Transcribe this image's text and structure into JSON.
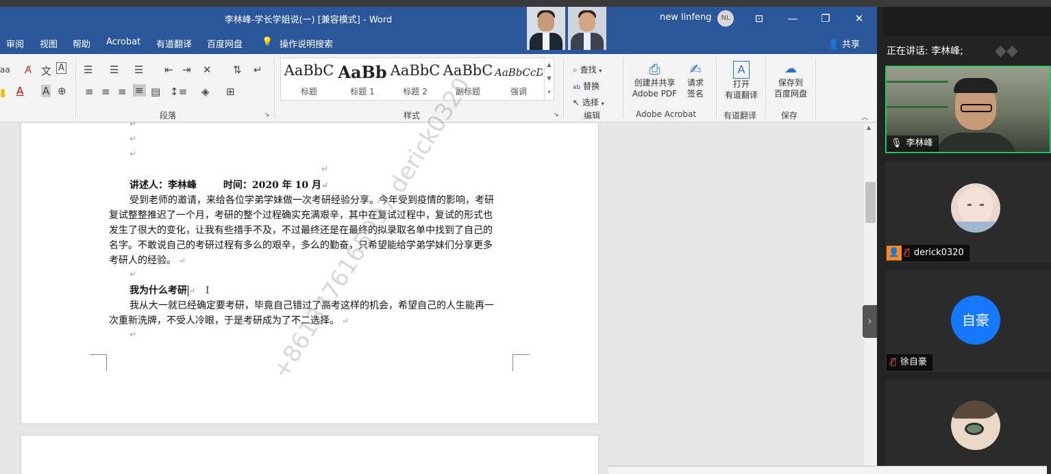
{
  "word": {
    "title": "李林峰-学长学姐说(一) [兼容模式]  -  Word",
    "user_name": "new linfeng",
    "user_initials": "NL",
    "share_label": "共享",
    "menu": [
      "审阅",
      "视图",
      "帮助",
      "Acrobat",
      "有道翻译",
      "百度网盘"
    ],
    "tell_me": "操作说明搜索",
    "ribbon": {
      "font_fragment": "aa",
      "paragraph_group": "段落",
      "styles_group": "样式",
      "styles": [
        {
          "sample": "AaBbC",
          "name": "标题"
        },
        {
          "sample": "AaBb",
          "name": "标题 1"
        },
        {
          "sample": "AaBbC",
          "name": "标题 2"
        },
        {
          "sample": "AaBbC",
          "name": "副标题"
        },
        {
          "sample": "AaBbCcD",
          "name": "强调"
        }
      ],
      "find": "查找",
      "replace": "替换",
      "select": "选择",
      "editing_group": "编辑",
      "create_share_pdf_1": "创建并共享",
      "create_share_pdf_2": "Adobe PDF",
      "request_sign_1": "请求",
      "request_sign_2": "签名",
      "acrobat_group": "Adobe Acrobat",
      "youdao_open_1": "打开",
      "youdao_open_2": "有道翻译",
      "youdao_group": "有道翻译",
      "baidu_save_1": "保存到",
      "baidu_save_2": "百度网盘",
      "save_group": "保存"
    },
    "document": {
      "byline_a": "讲述人：李林峰",
      "byline_b": "时间：2020 年 10 月",
      "para1_lines": [
        "受到老师的邀请，来给各位学弟学妹做一次考研经验分享。今年受到疫情的影响，考研",
        "复试整整推迟了一个月，考研的整个过程确实充满艰辛，其中在复试过程中，复试的形式也",
        "发生了很大的变化，让我有些措手不及，不过最终还是在最终的拟录取名单中找到了自己的",
        "名字。不敢说自己的考研过程有多么的艰辛，多么的勤奋，只希望能给学弟学妹们分享更多",
        "考研人的经验。"
      ],
      "heading": "我为什么考研",
      "para2_lines": [
        "我从大一就已经确定要考研，毕竟自己错过了高考这样的机会，希望自己的人生能再一",
        "次重新洗牌，不受人冷眼，于是考研成为了不二选择。"
      ],
      "watermark": "+8613476165997 derick0320"
    }
  },
  "meeting": {
    "speaking_label": "正在讲话: 李林峰;",
    "participants": [
      {
        "name": "李林峰",
        "type": "video"
      },
      {
        "name": "derick0320",
        "type": "avatar"
      },
      {
        "name": "徐自豪",
        "type": "initials",
        "initials": "自豪"
      },
      {
        "name": "",
        "type": "avatar"
      }
    ]
  },
  "colors": {
    "word_blue": "#2b579a",
    "active_speaker": "#22c55e",
    "initials_bg": "#1677ff"
  }
}
